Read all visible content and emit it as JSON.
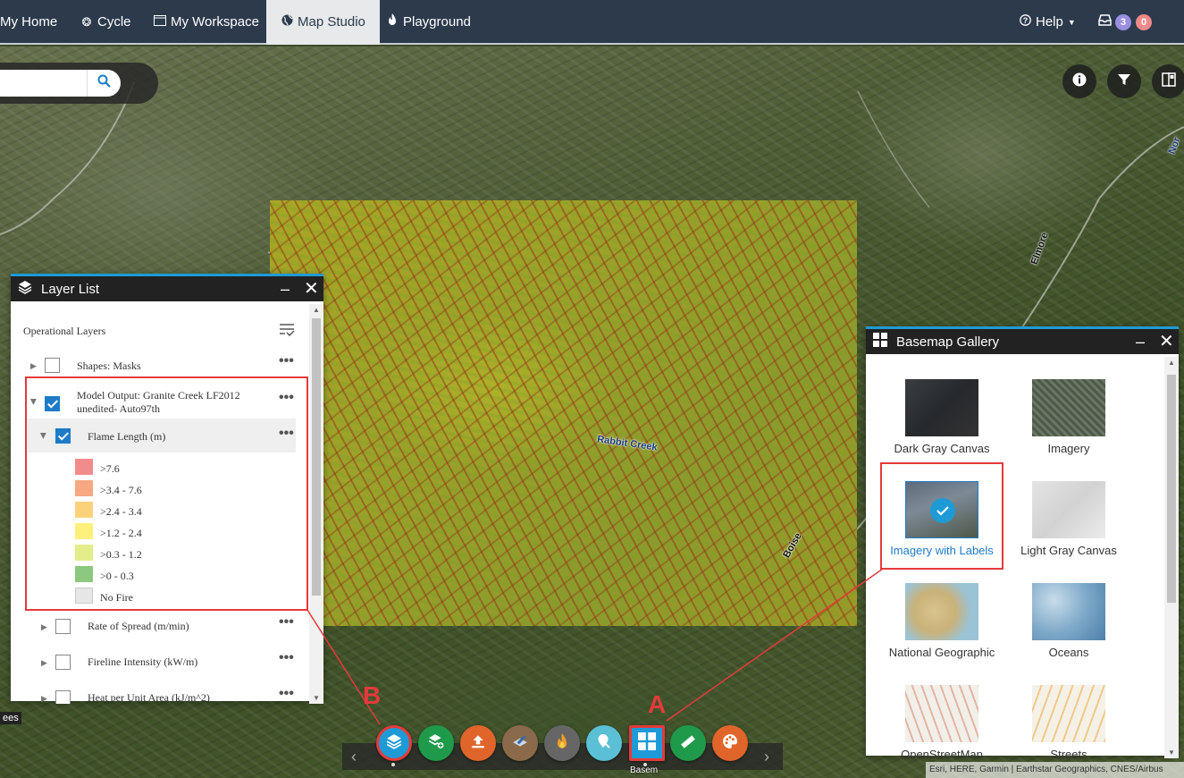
{
  "nav": {
    "items": [
      {
        "label": "My Home",
        "icon": "home-icon"
      },
      {
        "label": "Cycle",
        "icon": "cycle-icon"
      },
      {
        "label": "My Workspace",
        "icon": "workspace-icon"
      },
      {
        "label": "Map Studio",
        "icon": "globe-icon",
        "active": true
      },
      {
        "label": "Playground",
        "icon": "fire-icon"
      }
    ],
    "help_label": "Help",
    "inbox_count_1": "3",
    "inbox_count_2": "0"
  },
  "search": {
    "placeholder": ""
  },
  "map_labels": {
    "creek": "Rabbit Creek",
    "river": "Boise",
    "elmore": "Elmore",
    "north": "Nor",
    "trees": "ees"
  },
  "layer_list": {
    "title": "Layer List",
    "section_title": "Operational Layers",
    "layers": [
      {
        "label": "Shapes: Masks",
        "checked": false
      },
      {
        "label": "Model Output: Granite Creek LF2012",
        "label2": "unedited- Auto97th",
        "checked": true
      },
      {
        "label": "Flame Length (m)",
        "checked": true
      },
      {
        "label": "Rate of Spread (m/min)",
        "checked": false
      },
      {
        "label": "Fireline Intensity (kW/m)",
        "checked": false
      },
      {
        "label": "Heat per Unit Area (kJ/m^2)",
        "checked": false
      }
    ],
    "legend": [
      {
        "label": ">7.6",
        "color": "#f28b8b"
      },
      {
        "label": ">3.4 - 7.6",
        "color": "#f6a882"
      },
      {
        "label": ">2.4 - 3.4",
        "color": "#fbd27a"
      },
      {
        "label": ">1.2 - 2.4",
        "color": "#fdf07c"
      },
      {
        "label": ">0.3 - 1.2",
        "color": "#e3ee8b"
      },
      {
        "label": ">0 - 0.3",
        "color": "#8cc87f"
      },
      {
        "label": "No Fire",
        "color": "#e6e6e6"
      }
    ]
  },
  "basemap": {
    "title": "Basemap Gallery",
    "items": [
      {
        "label": "Dark Gray Canvas"
      },
      {
        "label": "Imagery"
      },
      {
        "label": "Imagery with Labels",
        "selected": true
      },
      {
        "label": "Light Gray Canvas"
      },
      {
        "label": "National Geographic"
      },
      {
        "label": "Oceans"
      },
      {
        "label": "OpenStreetMap"
      },
      {
        "label": "Streets"
      }
    ]
  },
  "callouts": {
    "a": "A",
    "b": "B"
  },
  "toolbar": {
    "tools": [
      {
        "name": "layer-list-tool",
        "color": "#1e9ad6"
      },
      {
        "name": "add-data-tool",
        "color": "#1f9a4a"
      },
      {
        "name": "upload-tool",
        "color": "#e0652a"
      },
      {
        "name": "edit-tool",
        "color": "#8a6a4a"
      },
      {
        "name": "fire-tool",
        "color": "#666666"
      },
      {
        "name": "location-tool",
        "color": "#5bc0d6"
      },
      {
        "name": "basemap-tool",
        "color": "#1e9ad6"
      },
      {
        "name": "measure-tool",
        "color": "#1f9a4a"
      },
      {
        "name": "palette-tool",
        "color": "#e0652a"
      }
    ],
    "active_label": "Basem"
  },
  "attribution": "Esri, HERE, Garmin | Earthstar Geographics, CNES/Airbus"
}
